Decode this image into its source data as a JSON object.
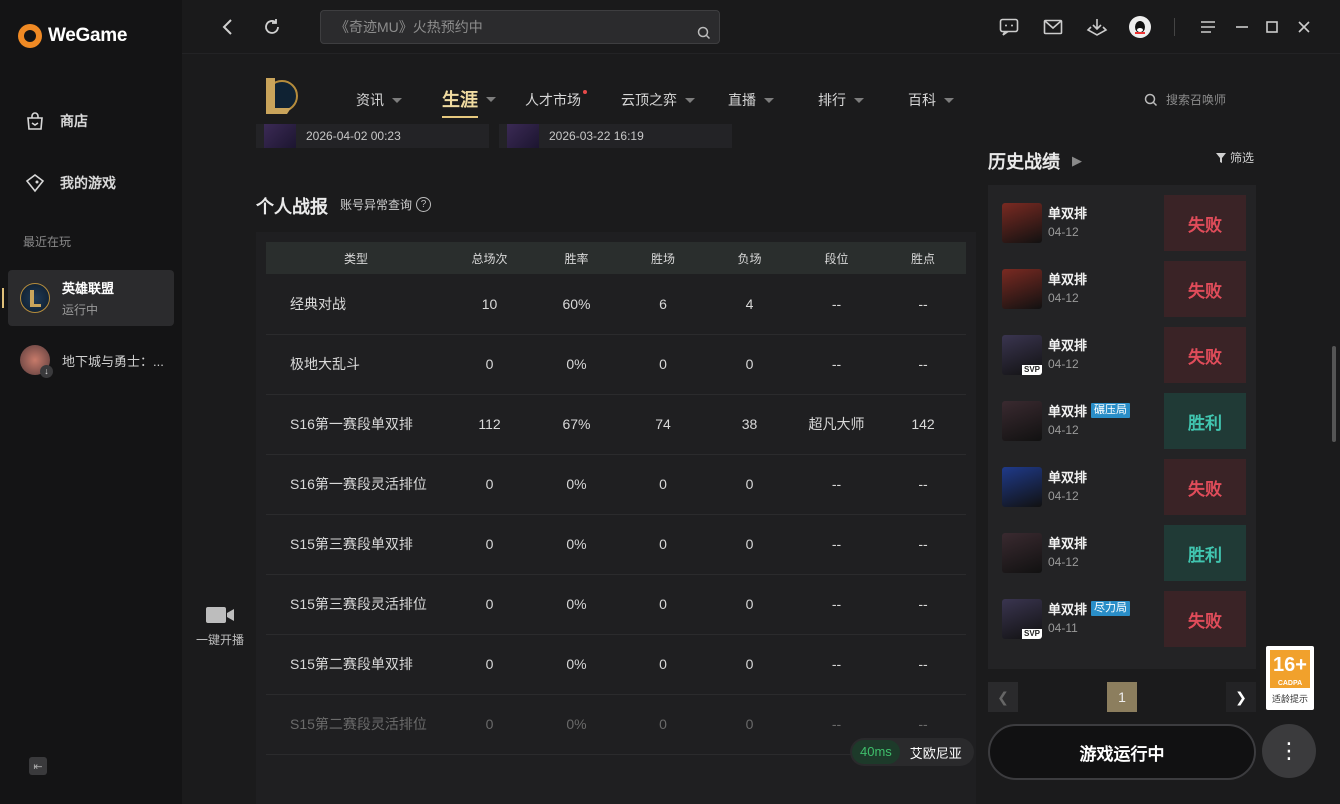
{
  "app": {
    "name": "WeGame"
  },
  "sidebar": {
    "items": [
      {
        "label": "商店"
      },
      {
        "label": "我的游戏"
      }
    ],
    "recent_label": "最近在玩",
    "games": [
      {
        "title": "英雄联盟",
        "status": "运行中"
      },
      {
        "title": "地下城与勇士：..."
      }
    ]
  },
  "topbar": {
    "search_placeholder": "《奇迹MU》火热预约中"
  },
  "lol_nav": {
    "tabs": [
      {
        "label": "资讯"
      },
      {
        "label": "生涯"
      },
      {
        "label": "人才市场"
      },
      {
        "label": "云顶之弈"
      },
      {
        "label": "直播"
      },
      {
        "label": "排行"
      },
      {
        "label": "百科"
      }
    ],
    "summoner_search": "搜索召唤师"
  },
  "recent_thumbs": [
    {
      "date": "2026-04-02 00:23"
    },
    {
      "date": "2026-03-22 16:19"
    }
  ],
  "stats": {
    "title": "个人战报",
    "anomaly_link": "账号异常查询",
    "columns": [
      "类型",
      "总场次",
      "胜率",
      "胜场",
      "负场",
      "段位",
      "胜点"
    ],
    "rows": [
      [
        "经典对战",
        "10",
        "60%",
        "6",
        "4",
        "--",
        "--"
      ],
      [
        "极地大乱斗",
        "0",
        "0%",
        "0",
        "0",
        "--",
        "--"
      ],
      [
        "S16第一赛段单双排",
        "112",
        "67%",
        "74",
        "38",
        "超凡大师",
        "142"
      ],
      [
        "S16第一赛段灵活排位",
        "0",
        "0%",
        "0",
        "0",
        "--",
        "--"
      ],
      [
        "S15第三赛段单双排",
        "0",
        "0%",
        "0",
        "0",
        "--",
        "--"
      ],
      [
        "S15第三赛段灵活排位",
        "0",
        "0%",
        "0",
        "0",
        "--",
        "--"
      ],
      [
        "S15第二赛段单双排",
        "0",
        "0%",
        "0",
        "0",
        "--",
        "--"
      ],
      [
        "S15第二赛段灵活排位",
        "0",
        "0%",
        "0",
        "0",
        "--",
        "--"
      ]
    ]
  },
  "broadcast": {
    "label": "一键开播"
  },
  "history": {
    "title": "历史战绩",
    "filter_label": "筛选",
    "matches": [
      {
        "mode": "单双排",
        "tag": "",
        "date": "04-12",
        "result": "失败",
        "win": false,
        "svp": false,
        "color": "#7a2a22"
      },
      {
        "mode": "单双排",
        "tag": "",
        "date": "04-12",
        "result": "失败",
        "win": false,
        "svp": false,
        "color": "#7a2a22"
      },
      {
        "mode": "单双排",
        "tag": "",
        "date": "04-12",
        "result": "失败",
        "win": false,
        "svp": true,
        "svp_label": "SVP",
        "color": "#3a3550"
      },
      {
        "mode": "单双排",
        "tag": "碾压局",
        "date": "04-12",
        "result": "胜利",
        "win": true,
        "svp": false,
        "color": "#3a2a30"
      },
      {
        "mode": "单双排",
        "tag": "",
        "date": "04-12",
        "result": "失败",
        "win": false,
        "svp": false,
        "color": "#1f3a8a"
      },
      {
        "mode": "单双排",
        "tag": "",
        "date": "04-12",
        "result": "胜利",
        "win": true,
        "svp": false,
        "color": "#3a2a30"
      },
      {
        "mode": "单双排",
        "tag": "尽力局",
        "date": "04-11",
        "result": "失败",
        "win": false,
        "svp": true,
        "svp_label": "SVP",
        "color": "#3a3550"
      }
    ],
    "page": "1"
  },
  "bottom": {
    "ping": "40ms",
    "server": "艾欧尼亚",
    "run_button": "游戏运行中",
    "more_icon": "⋮"
  },
  "age_badge": {
    "rating": "16+",
    "org": "CADPA",
    "note": "适龄提示"
  }
}
